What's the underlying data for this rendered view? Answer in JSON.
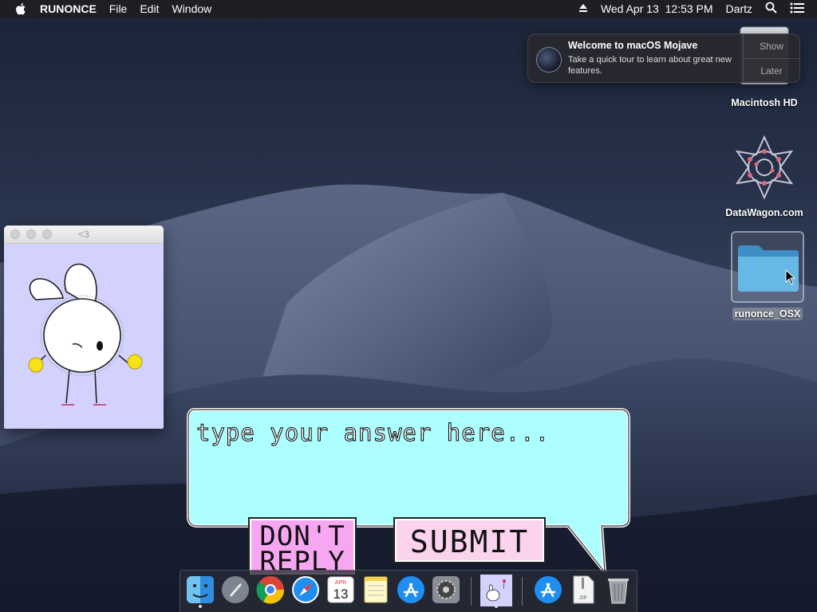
{
  "menubar": {
    "app_name": "RUNONCE",
    "menus": [
      "File",
      "Edit",
      "Window"
    ],
    "datetime": "Wed Apr 13  12:53 PM",
    "user": "Dartz"
  },
  "notification": {
    "title": "Welcome to macOS Mojave",
    "body": "Take a quick tour to learn about great new features.",
    "show_label": "Show",
    "later_label": "Later"
  },
  "desktop_icons": {
    "macintosh_hd": "Macintosh HD",
    "datawagon": "DataWagon.com",
    "runonce_folder": "runonce_OSX"
  },
  "heart_window": {
    "title": "<3",
    "background_color": "#d3d2fe"
  },
  "answer_box": {
    "placeholder": "type your answer here...",
    "bubble_color": "#acfeff"
  },
  "buttons": {
    "dont_reply_label": "DON'T REPLY",
    "submit_label": "SUBMIT"
  },
  "dock": {
    "calendar_month": "APR",
    "calendar_day": "13",
    "zip_label": "ZIP"
  }
}
